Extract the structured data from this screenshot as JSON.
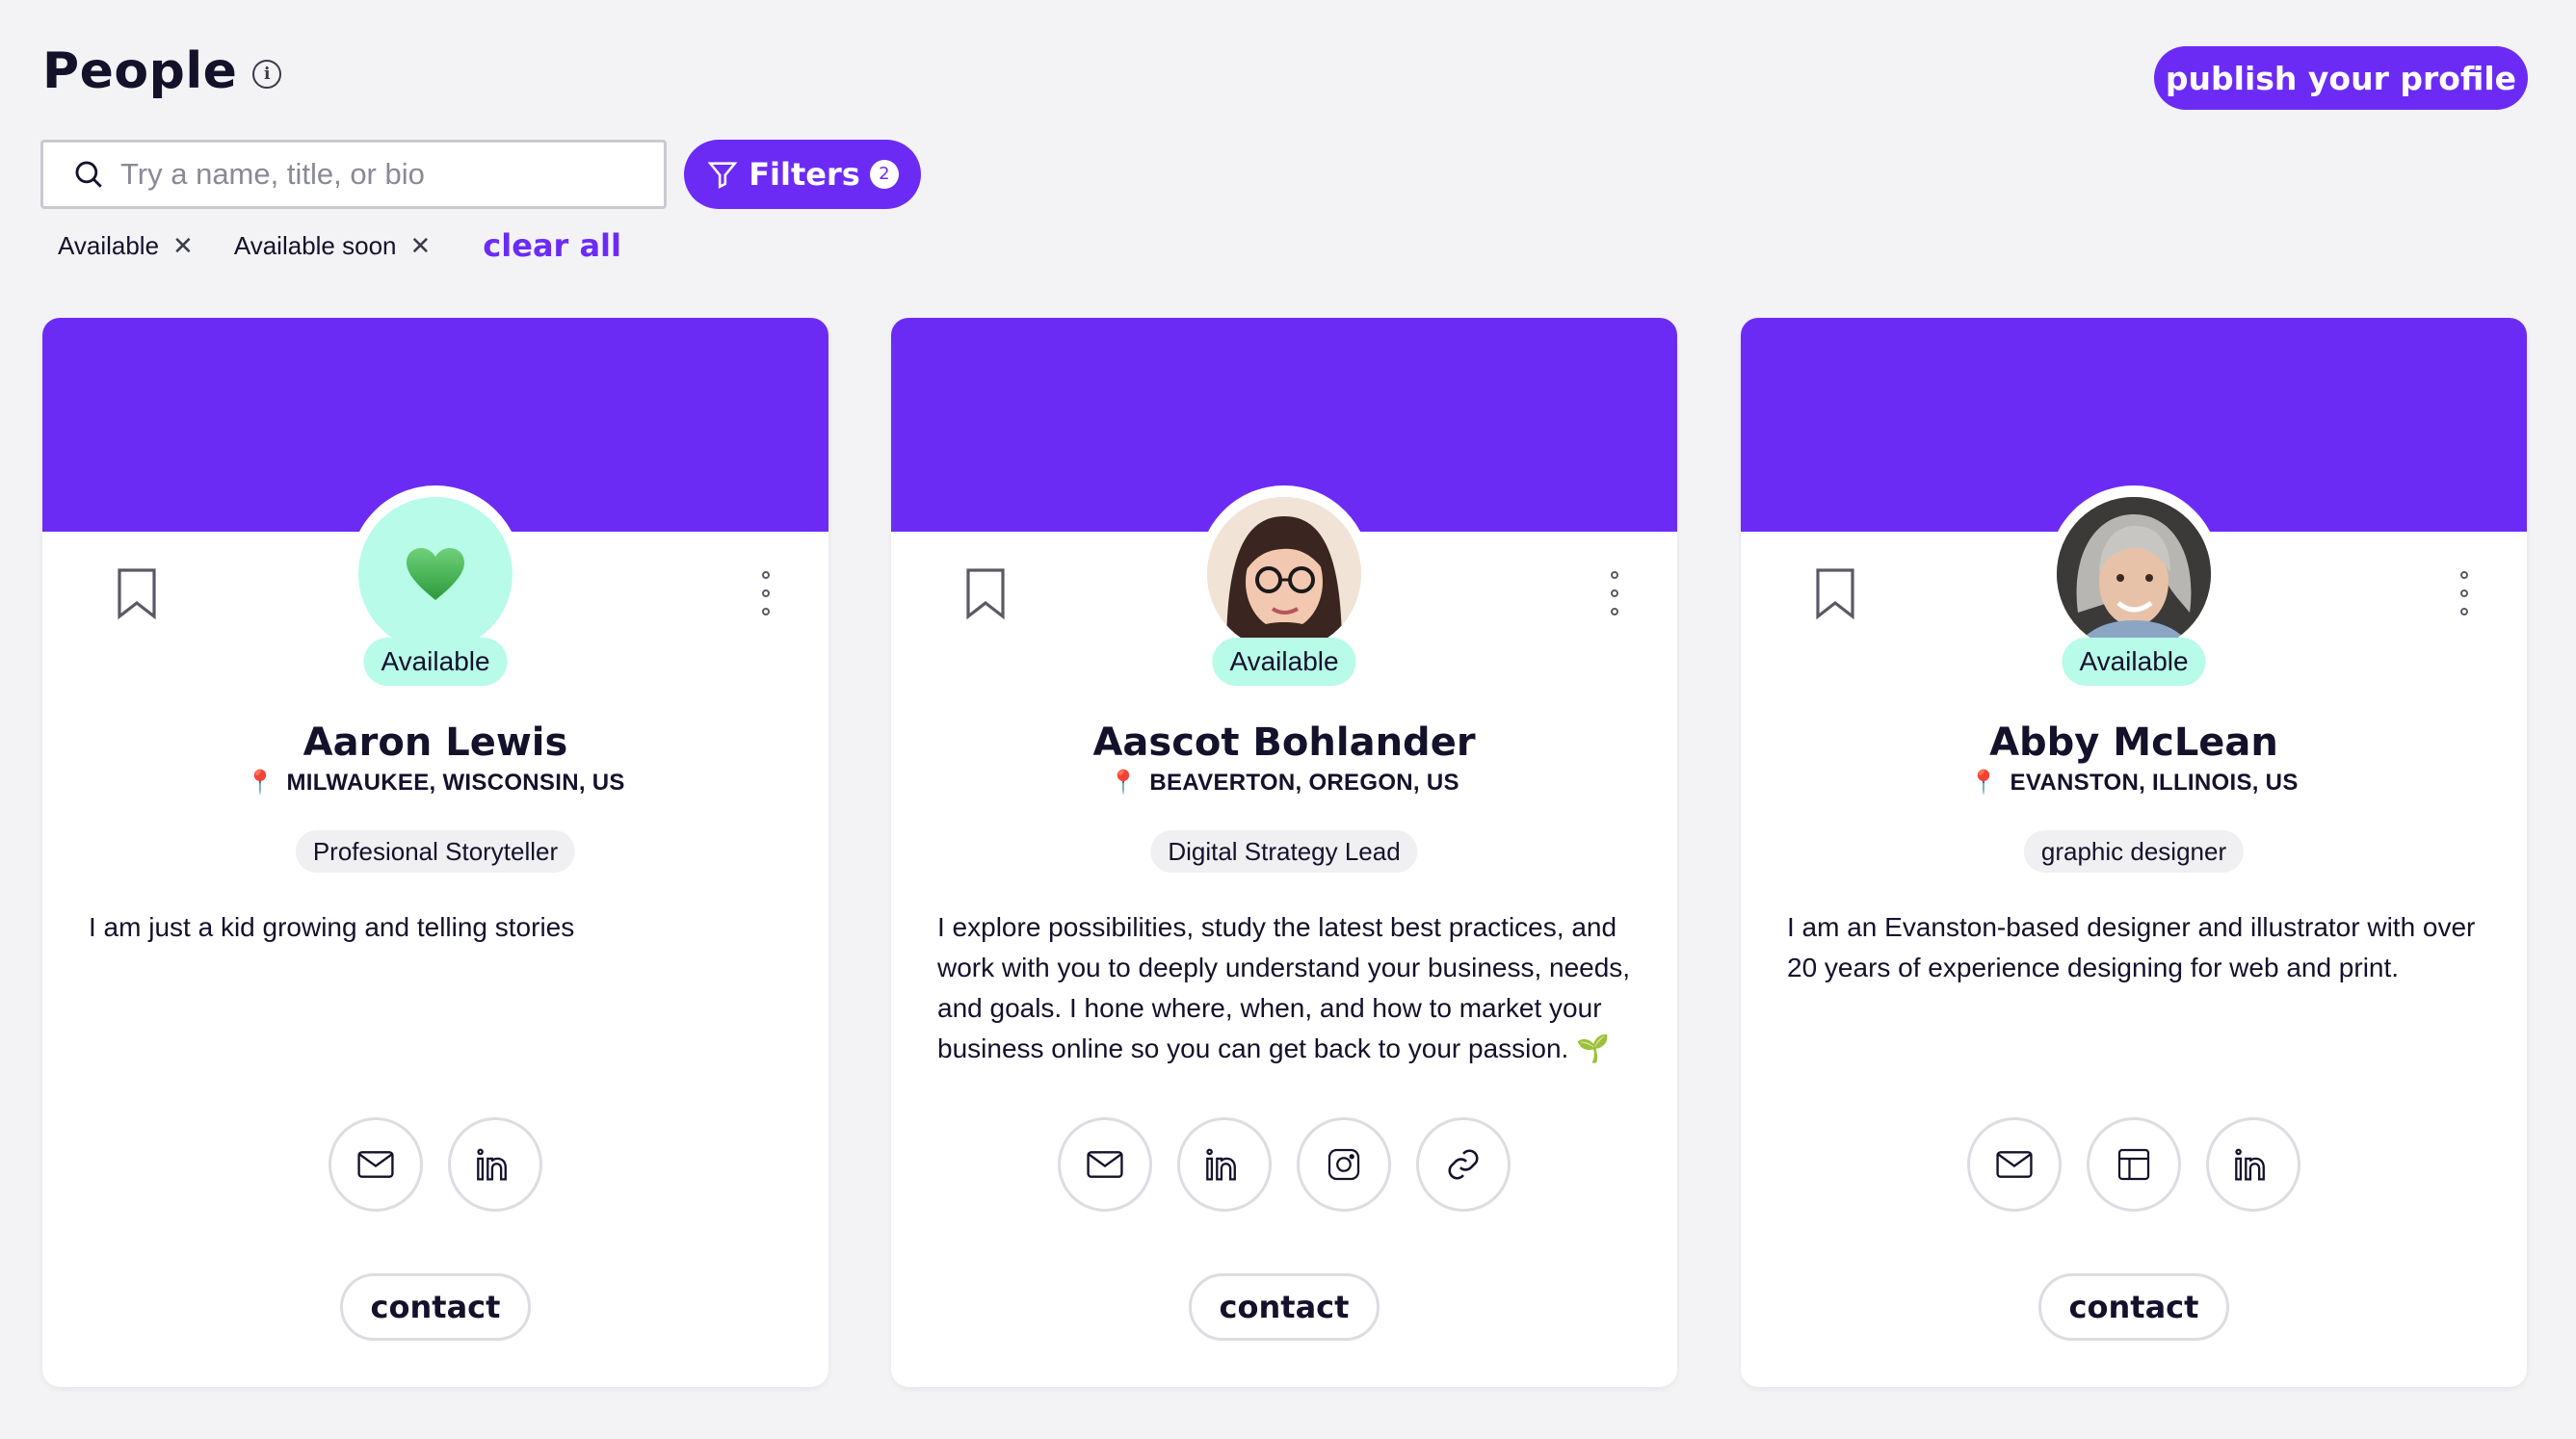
{
  "header": {
    "title": "People",
    "publish_label": "publish your profile"
  },
  "search": {
    "placeholder": "Try a name, title, or bio",
    "value": ""
  },
  "filters": {
    "label": "Filters",
    "count": "2"
  },
  "chips": [
    {
      "label": "Available"
    },
    {
      "label": "Available soon"
    }
  ],
  "clear_all": "clear all",
  "colors": {
    "accent": "#6c2bf5",
    "status_badge": "#b7fbe8",
    "background": "#f3f3f6"
  },
  "cards": [
    {
      "name": "Aaron Lewis",
      "location": "MILWAUKEE, WISCONSIN, US",
      "status": "Available",
      "role": "Profesional Storyteller",
      "bio": "I am just a kid growing and telling stories",
      "avatar": "green-heart-emoji",
      "links": [
        "mail-icon",
        "linkedin-icon"
      ],
      "contact_label": "contact"
    },
    {
      "name": "Aascot Bohlander",
      "location": "BEAVERTON, OREGON, US",
      "status": "Available",
      "role": "Digital Strategy Lead",
      "bio": "I explore possibilities, study the latest best practices, and work with you to deeply understand your business, needs, and goals. I hone where, when, and how to market your business online so you can get back to your passion. 🌱",
      "avatar": "photo-woman-glasses",
      "links": [
        "mail-icon",
        "linkedin-icon",
        "instagram-icon",
        "link-icon"
      ],
      "contact_label": "contact"
    },
    {
      "name": "Abby McLean",
      "location": "EVANSTON, ILLINOIS, US",
      "status": "Available",
      "role": "graphic designer",
      "bio": "I am an Evanston-based designer and illustrator with over 20 years of experience designing for web and print.",
      "avatar": "photo-woman-gray-hair",
      "links": [
        "mail-icon",
        "portfolio-icon",
        "linkedin-icon"
      ],
      "contact_label": "contact"
    }
  ]
}
